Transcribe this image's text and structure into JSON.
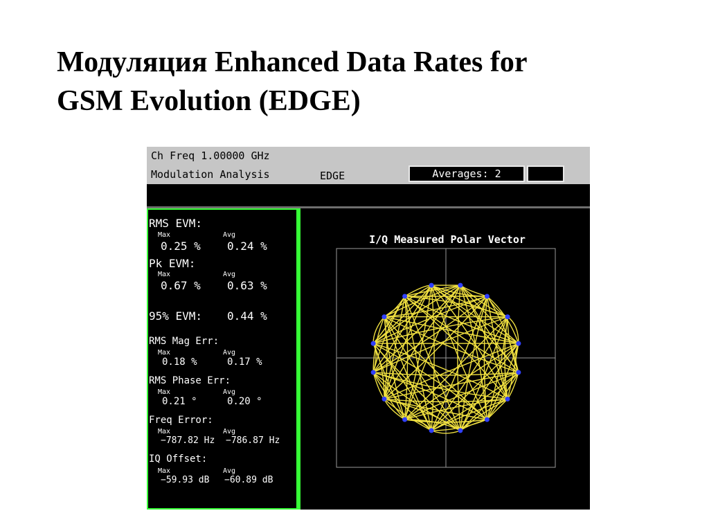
{
  "slide": {
    "title_line1": "Модуляция Enhanced Data Rates for",
    "title_line2": "GSM Evolution (EDGE)"
  },
  "analyzer": {
    "ch_freq": "Ch Freq 1.00000 GHz",
    "mode": "Modulation Analysis",
    "standard": "EDGE",
    "averages": "Averages: 2",
    "plot_title": "I/Q Measured Polar Vector",
    "colors": {
      "trace": "#f0e040",
      "symbol": "#3040ff",
      "panel_border": "#37ff37",
      "grid": "#9a9a9a"
    },
    "metrics": {
      "rms_evm": {
        "label": "RMS EVM:",
        "max_label": "Max",
        "avg_label": "Avg",
        "max": "0.25 %",
        "avg": "0.24 %"
      },
      "pk_evm": {
        "label": "Pk EVM:",
        "max_label": "Max",
        "avg_label": "Avg",
        "max": "0.67 %",
        "avg": "0.63 %"
      },
      "evm95": {
        "label": "95% EVM:",
        "value": "0.44 %"
      },
      "rms_mag_err": {
        "label": "RMS Mag Err:",
        "max_label": "Max",
        "avg_label": "Avg",
        "max": "0.18 %",
        "avg": "0.17 %"
      },
      "rms_phase_err": {
        "label": "RMS Phase Err:",
        "max_label": "Max",
        "avg_label": "Avg",
        "max": "0.21 °",
        "avg": "0.20 °"
      },
      "freq_error": {
        "label": "Freq Error:",
        "max_label": "Max",
        "avg_label": "Avg",
        "max": "−787.82 Hz",
        "avg": "−786.87 Hz"
      },
      "iq_offset": {
        "label": "IQ Offset:",
        "max_label": "Max",
        "avg_label": "Avg",
        "max": "−59.93 dB",
        "avg": "−60.89 dB"
      }
    }
  }
}
